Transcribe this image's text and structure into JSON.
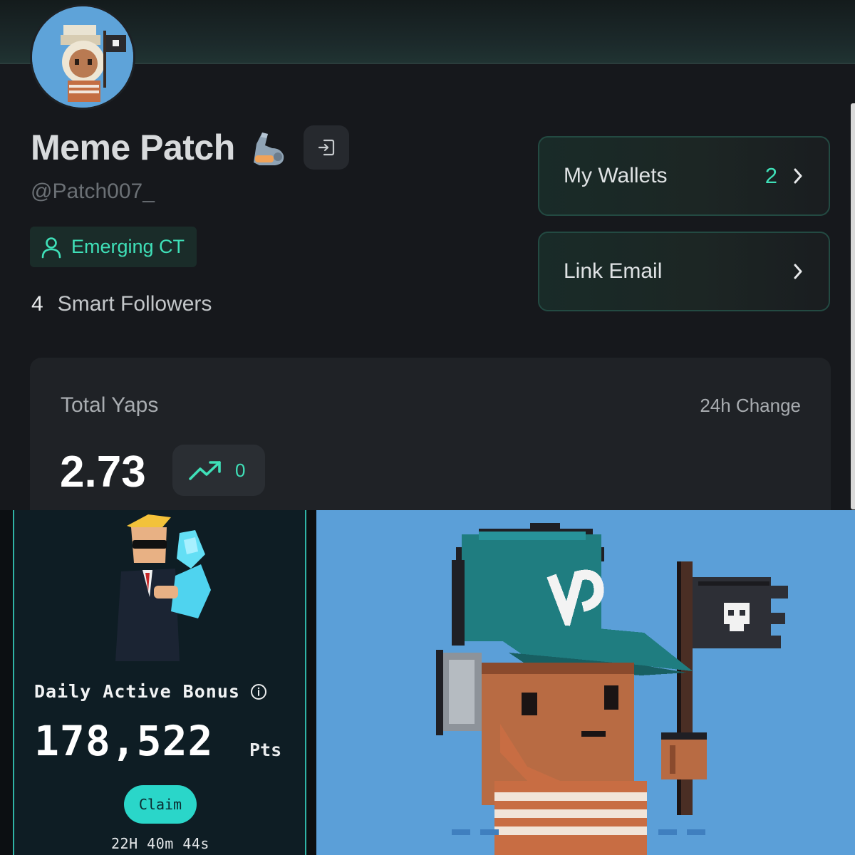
{
  "profile": {
    "display_name": "Meme Patch",
    "emoji_icon": "mechanical-arm-emoji",
    "handle": "@Patch007_",
    "tier_badge": "Emerging CT",
    "smart_followers": {
      "count": "4",
      "label": "Smart Followers"
    }
  },
  "side_cards": {
    "wallets": {
      "label": "My Wallets",
      "count": "2"
    },
    "email": {
      "label": "Link Email"
    }
  },
  "yaps": {
    "title": "Total Yaps",
    "change_label": "24h Change",
    "value": "2.73",
    "change_value": "0"
  },
  "bonus": {
    "title": "Daily Active Bonus",
    "value": "178,522",
    "unit": "Pts",
    "claim_label": "Claim",
    "countdown": "22H 40m 44s"
  },
  "colors": {
    "accent": "#3fe0b8",
    "claim_button": "#2ad6c9",
    "card_bg": "#1f2226",
    "pixel_bg": "#5b9fd8",
    "cap": "#1f7d80"
  },
  "icons": [
    "logout-icon",
    "user-icon",
    "chevron-right-icon",
    "trend-up-icon",
    "info-icon",
    "vine-logo-icon",
    "skull-flag-icon"
  ]
}
